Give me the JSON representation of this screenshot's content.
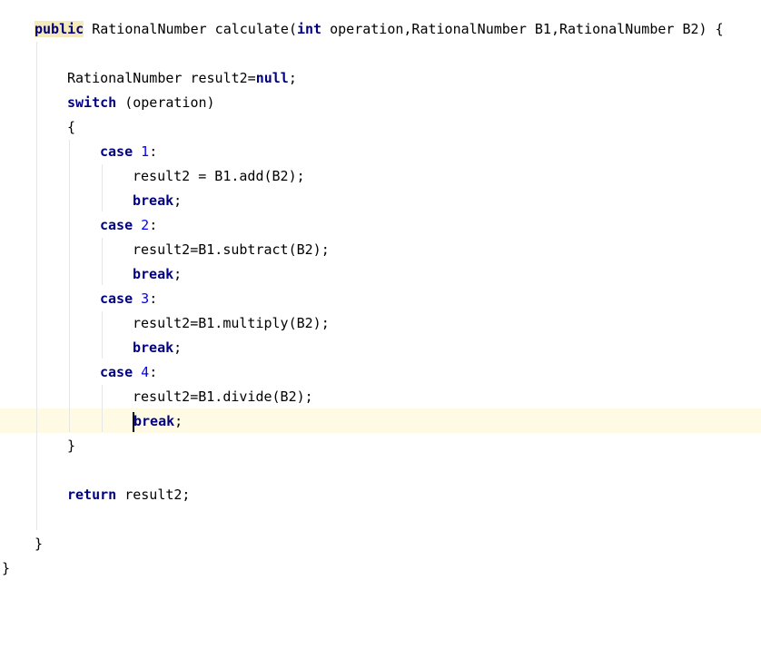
{
  "colors": {
    "background": "#ffffff",
    "keyword": "#000080",
    "number": "#0000ff",
    "text": "#000000",
    "current_line": "#fffae3",
    "keyword_highlight": "#f5eabc",
    "indent_guide": "#e6e6e6"
  },
  "code": {
    "sig_public": "public",
    "sig_rest_1": " RationalNumber calculate(",
    "sig_int": "int",
    "sig_rest_2": " operation,RationalNumber B1,RationalNumber B2) {",
    "decl_text": "RationalNumber result2=",
    "decl_null": "null",
    "decl_end": ";",
    "switch_kw": "switch",
    "switch_rest": " (operation)",
    "open_brace": "{",
    "case_kw": "case",
    "case1_num": "1",
    "case1_stmt": "result2 = B1.add(B2);",
    "case2_num": "2",
    "case2_stmt": "result2=B1.subtract(B2);",
    "case3_num": "3",
    "case3_stmt": "result2=B1.multiply(B2);",
    "case4_num": "4",
    "case4_stmt": "result2=B1.divide(B2);",
    "colon": ":",
    "break_kw": "break",
    "break_b": "b",
    "break_rest": "reak",
    "semicolon": ";",
    "close_brace": "}",
    "return_kw": "return",
    "return_rest": " result2;"
  }
}
